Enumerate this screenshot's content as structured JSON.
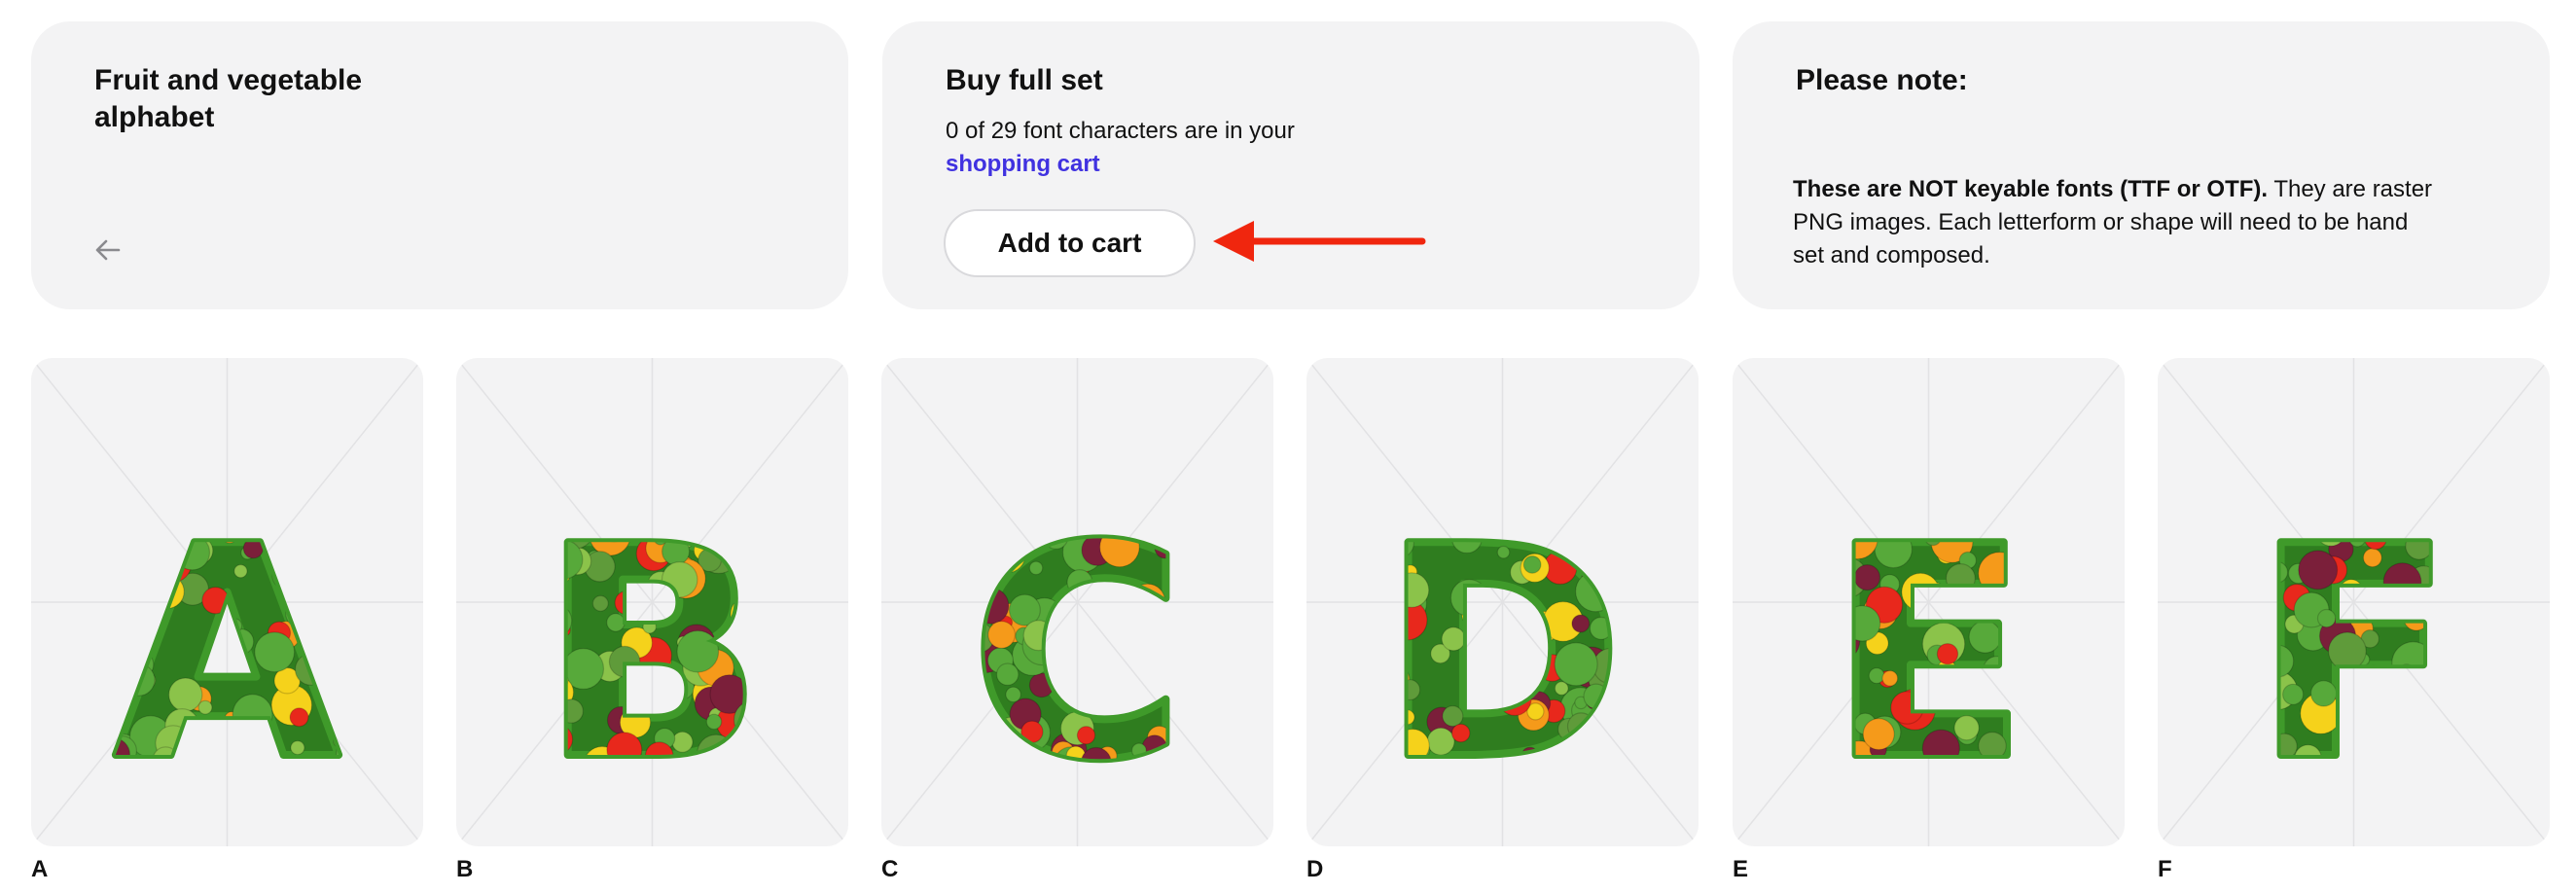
{
  "title_panel": {
    "title": "Fruit and vegetable alphabet",
    "back_icon": "arrow-left-icon"
  },
  "buy_panel": {
    "title": "Buy full set",
    "cart_text_before": "0 of 29 font characters are in your ",
    "cart_link": "shopping cart",
    "add_button": "Add to cart",
    "arrow_color": "#f0260e"
  },
  "note_panel": {
    "title": "Please note:",
    "note_bold": "These are NOT keyable fonts (TTF or OTF).",
    "note_rest": " They are raster PNG images. Each letterform or shape will need to be hand set and composed."
  },
  "tiles": [
    {
      "letter": "A",
      "label": "A"
    },
    {
      "letter": "B",
      "label": "B"
    },
    {
      "letter": "C",
      "label": "C"
    },
    {
      "letter": "D",
      "label": "D"
    },
    {
      "letter": "E",
      "label": "E"
    },
    {
      "letter": "F",
      "label": "F"
    }
  ],
  "colors": {
    "panel_bg": "#f3f3f4",
    "link": "#4032e0",
    "leaf_green": "#2f7d1f",
    "produce": [
      "#e8281c",
      "#f59a1a",
      "#8bc34a",
      "#7b1f3a",
      "#f5d21b",
      "#5f9b3a"
    ]
  }
}
